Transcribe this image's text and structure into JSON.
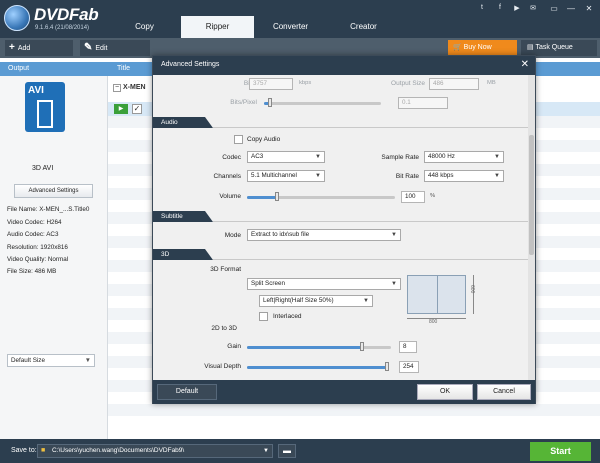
{
  "app": {
    "brand": "DVDFab",
    "version": "9.1.6.4 (21/08/2014)",
    "tabs": [
      "Copy",
      "Ripper",
      "Converter",
      "Creator"
    ],
    "active_tab": "Ripper",
    "social_icons": [
      "twitter-icon",
      "facebook-icon",
      "youtube-icon",
      "email-icon"
    ],
    "window_buttons": [
      "minimize-icon",
      "restore-icon",
      "close-icon"
    ],
    "window_glyphs": [
      "▭",
      "—",
      "✕"
    ]
  },
  "toolbar": {
    "add_label": "Add",
    "add_icon": "+",
    "edit_label": "Edit",
    "buy_label": "Buy Now",
    "task_label": "Task Queue"
  },
  "columns": {
    "output": "Output",
    "title": "Title"
  },
  "left_panel": {
    "format_badge": "AVI",
    "format_name": "3D AVI",
    "advanced_button": "Advanced Settings",
    "info": [
      "File Name: X-MEN_...S.Title0",
      "Video Codec: H264",
      "Audio Codec: AC3",
      "Resolution: 1920x816",
      "Video Quality: Normal",
      "File Size: 486 MB"
    ],
    "size_select": "Default Size"
  },
  "title_list": {
    "group_label": "X-MEN",
    "row_checked": true
  },
  "bottom": {
    "save_label": "Save to:",
    "save_path": "C:\\Users\\yuchen.wang\\Documents\\DVDFab9\\",
    "start_label": "Start"
  },
  "dialog": {
    "title": "Advanced Settings",
    "close_glyph": "✕",
    "video": {
      "bitrate_label": "Bit Rate",
      "bitrate_value": "3757",
      "bitrate_unit": "kbps",
      "output_size_label": "Output Size",
      "output_size_value": "486",
      "output_size_unit": "MB",
      "bits_pixel_label": "Bits/Pixel",
      "bits_pixel_value": "0.1",
      "bits_pixel_level": 0.05
    },
    "audio": {
      "section": "Audio",
      "copy_audio_label": "Copy Audio",
      "copy_audio_checked": false,
      "codec_label": "Codec",
      "codec_value": "AC3",
      "sample_rate_label": "Sample Rate",
      "sample_rate_value": "48000 Hz",
      "channels_label": "Channels",
      "channels_value": "5.1 Multichannel",
      "bitrate_label": "Bit Rate",
      "bitrate_value": "448 kbps",
      "volume_label": "Volume",
      "volume_value": "100",
      "volume_unit": "%",
      "volume_level": 0.2
    },
    "subtitle": {
      "section": "Subtitle",
      "mode_label": "Mode",
      "mode_value": "Extract to idx\\sub file"
    },
    "threed": {
      "section": "3D",
      "format_label": "3D Format",
      "format_value": "Split Screen",
      "layout_value": "Left|Right(Half Size 50%)",
      "interlaced_label": "Interlaced",
      "interlaced_checked": false,
      "preview_width": "800",
      "preview_height": "600",
      "to3d_label": "2D to 3D",
      "gain_label": "Gain",
      "gain_value": "8",
      "gain_level": 0.8,
      "depth_label": "Visual Depth",
      "depth_value": "254",
      "depth_level": 1.0
    },
    "footer": {
      "default_label": "Default",
      "ok_label": "OK",
      "cancel_label": "Cancel"
    }
  }
}
